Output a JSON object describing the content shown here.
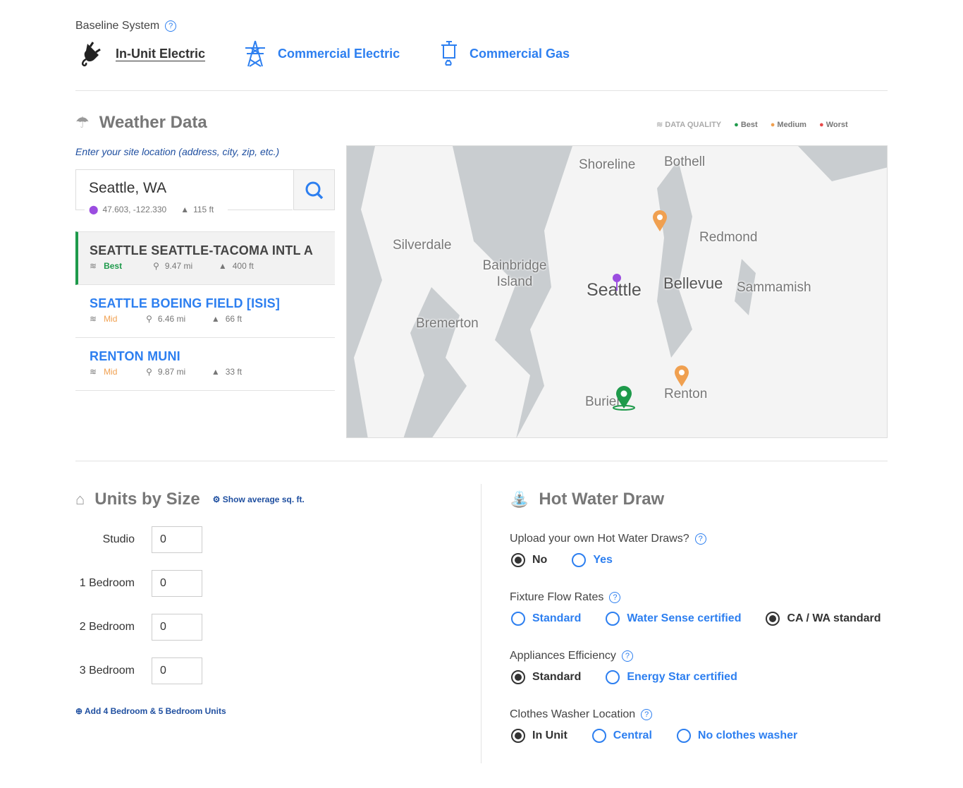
{
  "baseline": {
    "label": "Baseline System",
    "options": [
      {
        "label": "In-Unit Electric",
        "icon": "plug-icon",
        "selected": true
      },
      {
        "label": "Commercial Electric",
        "icon": "power-tower-icon",
        "selected": false
      },
      {
        "label": "Commercial Gas",
        "icon": "gas-boiler-icon",
        "selected": false
      }
    ]
  },
  "weather": {
    "title": "Weather Data",
    "hint": "Enter your site location (address, city, zip, etc.)",
    "search": {
      "value": "Seattle, WA",
      "coords": "47.603, -122.330",
      "elevation": "115 ft"
    },
    "legend": {
      "title": "DATA QUALITY",
      "best": "Best",
      "medium": "Medium",
      "worst": "Worst"
    },
    "stations": [
      {
        "name": "SEATTLE SEATTLE-TACOMA INTL A",
        "quality": "Best",
        "distance": "9.47 mi",
        "elevation": "400 ft",
        "selected": true
      },
      {
        "name": "SEATTLE BOEING FIELD [ISIS]",
        "quality": "Mid",
        "distance": "6.46 mi",
        "elevation": "66 ft",
        "selected": false
      },
      {
        "name": "RENTON MUNI",
        "quality": "Mid",
        "distance": "9.87 mi",
        "elevation": "33 ft",
        "selected": false
      }
    ],
    "map_labels": [
      "Shoreline",
      "Bothell",
      "Redmond",
      "Silverdale",
      "Bainbridge Island",
      "Seattle",
      "Bellevue",
      "Sammamish",
      "Bremerton",
      "Renton",
      "Burien"
    ]
  },
  "units": {
    "title": "Units by Size",
    "show_avg": "Show average sq. ft.",
    "rows": [
      {
        "label": "Studio",
        "value": "0"
      },
      {
        "label": "1 Bedroom",
        "value": "0"
      },
      {
        "label": "2 Bedroom",
        "value": "0"
      },
      {
        "label": "3 Bedroom",
        "value": "0"
      }
    ],
    "add": "Add 4 Bedroom & 5 Bedroom Units"
  },
  "hot_water": {
    "title": "Hot Water Draw",
    "questions": [
      {
        "label": "Upload your own Hot Water Draws?",
        "options": [
          "No",
          "Yes"
        ],
        "selected": 0
      },
      {
        "label": "Fixture Flow Rates",
        "options": [
          "Standard",
          "Water Sense certified",
          "CA / WA standard"
        ],
        "selected": 2
      },
      {
        "label": "Appliances Efficiency",
        "options": [
          "Standard",
          "Energy Star certified"
        ],
        "selected": 0
      },
      {
        "label": "Clothes Washer Location",
        "options": [
          "In Unit",
          "Central",
          "No clothes washer"
        ],
        "selected": 0
      }
    ]
  },
  "colors": {
    "accent": "#2d7ff0",
    "best": "#1e9a4b",
    "medium": "#f0a050",
    "worst": "#e84a4a",
    "pin_site": "#9b4de0"
  }
}
